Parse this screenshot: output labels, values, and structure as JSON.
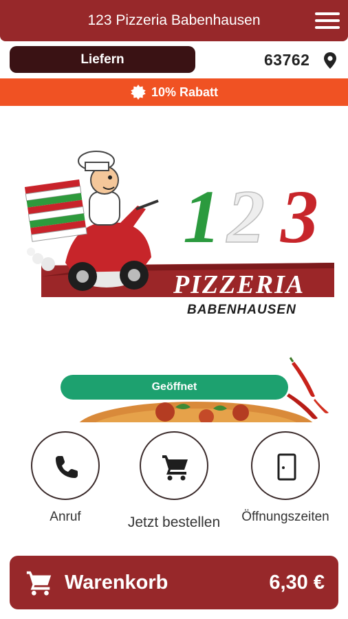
{
  "header": {
    "title": "123 Pizzeria Babenhausen",
    "menu_icon": "hamburger-menu-icon"
  },
  "delivery": {
    "mode_label": "Liefern",
    "postcode": "63762",
    "location_icon": "map-pin-icon"
  },
  "promo": {
    "text": "10% Rabatt",
    "icon": "badge-icon"
  },
  "logo": {
    "number": "123",
    "brand": "PIZZERIA",
    "city": "BABENHAUSEN"
  },
  "status": {
    "label": "Geöffnet",
    "color": "#1da16f"
  },
  "actions": [
    {
      "label": "Anruf",
      "icon": "phone-icon"
    },
    {
      "label": "Jetzt bestellen",
      "icon": "cart-icon"
    },
    {
      "label": "Öffnungszeiten",
      "icon": "door-icon"
    }
  ],
  "cart": {
    "label": "Warenkorb",
    "total": "6,30 €",
    "icon": "cart-icon"
  },
  "colors": {
    "brand": "#97282a",
    "promo": "#f05223",
    "dark": "#3a1214"
  }
}
